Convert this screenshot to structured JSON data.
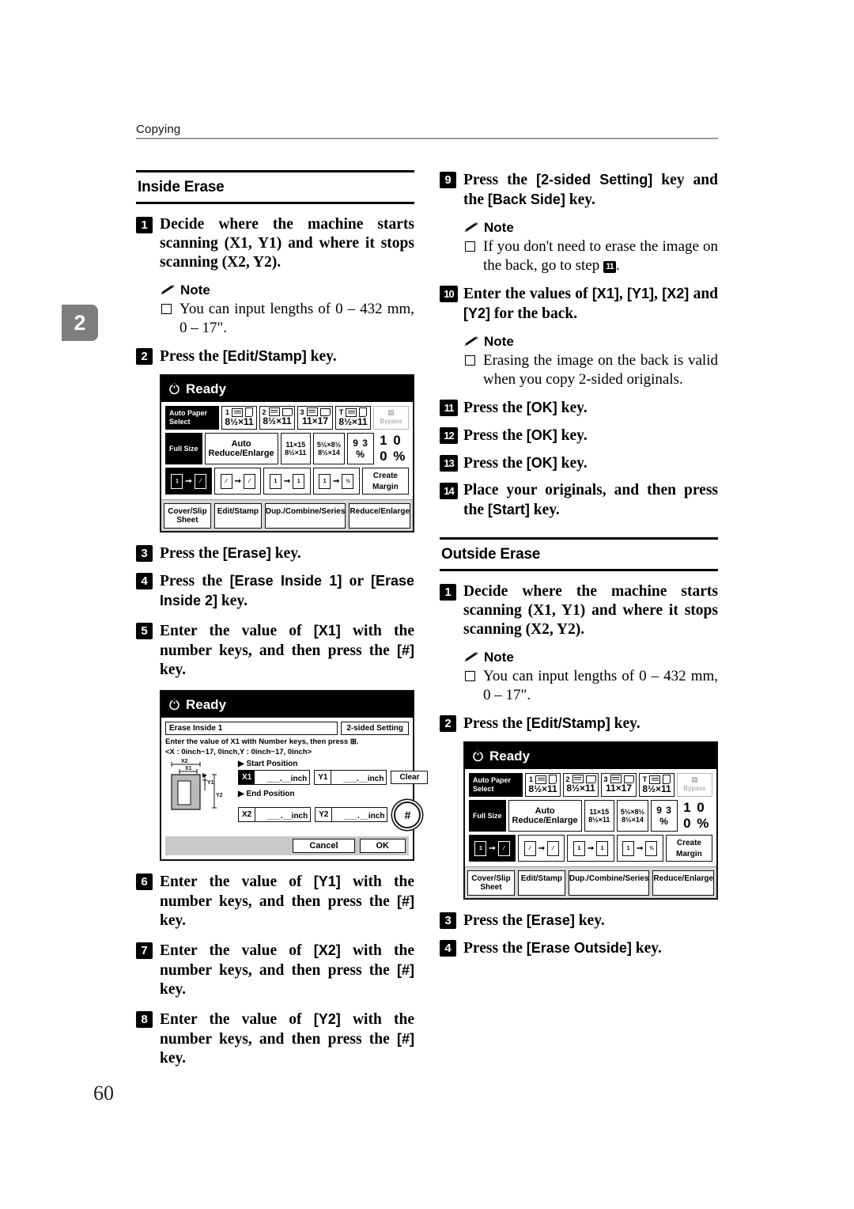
{
  "running_head": {
    "text": "Copying"
  },
  "chapter_tab": {
    "number": "2"
  },
  "page_number": "60",
  "left_column": {
    "section": {
      "title": "Inside Erase"
    },
    "steps": [
      {
        "num": "1",
        "text": "Decide where the machine starts scanning (X1, Y1) and where it stops scanning (X2, Y2)."
      },
      {
        "num": "2",
        "text_pre": "Press the ",
        "key": "[Edit/Stamp]",
        "text_post": " key."
      },
      {
        "num": "3",
        "text_pre": "Press the ",
        "key": "[Erase]",
        "text_post": " key."
      },
      {
        "num": "4",
        "text_pre": "Press the ",
        "key": "[Erase Inside 1]",
        "mid": " or ",
        "key2": "[Erase Inside 2]",
        "text_post": " key."
      },
      {
        "num": "5",
        "text_pre": "Enter the value of ",
        "key": "[X1]",
        "text_post": " with the number keys, and then press the ",
        "key2": "[#]",
        "tail": " key."
      },
      {
        "num": "6",
        "text_pre": "Enter the value of ",
        "key": "[Y1]",
        "text_post": " with the number keys, and then press the ",
        "key2": "[#]",
        "tail": " key."
      },
      {
        "num": "7",
        "text_pre": "Enter the value of ",
        "key": "[X2]",
        "text_post": " with the number keys, and then press the ",
        "key2": "[#]",
        "tail": " key."
      },
      {
        "num": "8",
        "text_pre": "Enter the value of ",
        "key": "[Y2]",
        "text_post": " with the number keys, and then press the ",
        "key2": "[#]",
        "tail": " key."
      }
    ],
    "note1": {
      "title": "Note",
      "item": "You can input lengths of 0 – 432 mm, 0 – 17\"."
    }
  },
  "right_column": {
    "steps": [
      {
        "num": "9",
        "text_pre": "Press the ",
        "key": "[2-sided Setting]",
        "mid": " key and the ",
        "key2": "[Back Side]",
        "text_post": " key."
      },
      {
        "num": "10",
        "text_pre": "Enter the values of ",
        "key": "[X1]",
        "k2": "[Y1]",
        "k3": "[X2]",
        "k4": "[Y2]",
        "text_post": " for the back."
      },
      {
        "num": "11",
        "text_pre": "Press the ",
        "key": "[OK]",
        "text_post": " key."
      },
      {
        "num": "12",
        "text_pre": "Press the ",
        "key": "[OK]",
        "text_post": " key."
      },
      {
        "num": "13",
        "text_pre": "Press the ",
        "key": "[OK]",
        "text_post": " key."
      },
      {
        "num": "14",
        "text_pre": "Place your originals, and then press the ",
        "key": "[Start]",
        "text_post": " key."
      }
    ],
    "note9": {
      "title": "Note",
      "item_pre": "If you don't need to erase the image on the back, go to step ",
      "step_ref": "11",
      "item_post": "."
    },
    "note10": {
      "title": "Note",
      "item": "Erasing the image on the back is valid when you copy 2-sided originals."
    },
    "section": {
      "title": "Outside Erase"
    },
    "outside_steps": [
      {
        "num": "1",
        "text": "Decide where the machine starts scanning (X1, Y1) and where it stops scanning (X2, Y2)."
      },
      {
        "num": "2",
        "text_pre": "Press the ",
        "key": "[Edit/Stamp]",
        "text_post": " key."
      },
      {
        "num": "3",
        "text_pre": "Press the ",
        "key": "[Erase]",
        "text_post": " key."
      },
      {
        "num": "4",
        "text_pre": "Press the ",
        "key": "[Erase Outside]",
        "text_post": " key."
      }
    ],
    "note_outside": {
      "title": "Note",
      "item": "You can input lengths of 0 – 432 mm, 0 – 17\"."
    }
  },
  "lcd_main": {
    "status": "Ready",
    "auto_paper_select": "Auto Paper Select",
    "paper_trays": [
      {
        "id": "1",
        "size": "8½×11"
      },
      {
        "id": "2",
        "size": "8½×11"
      },
      {
        "id": "3",
        "size": "11×17"
      },
      {
        "id": "T",
        "size": "8½×11"
      },
      {
        "id": "",
        "size": "Bypass"
      }
    ],
    "full_size": "Full Size",
    "auto_reduce": "Auto Reduce/Enlarge",
    "preset1_top": "11×15",
    "preset1_bot": "8½×11",
    "preset2_top": "5½×8½",
    "preset2_bot": "8½×14",
    "ratio_preset": "9 3 %",
    "ratio_current": "1 0 0 %",
    "create_margin_l1": "Create",
    "create_margin_l2": "Margin",
    "bottom_tabs": [
      "Cover/Slip Sheet",
      "Edit/Stamp",
      "Dup./Combine/Series",
      "Reduce/Enlarge"
    ]
  },
  "lcd_dialog": {
    "status": "Ready",
    "dialog_name": "Erase Inside 1",
    "two_sided_tab": "2-sided Setting",
    "instruction_line1": "Enter the value of X1 with Number keys, then press",
    "instruction_line2": "<X : 0inch~17, 0inch,Y : 0inch~17, 0inch>",
    "start_position": "Start Position",
    "end_position": "End Position",
    "fields": [
      {
        "tag": "X1",
        "value": "___.__inch"
      },
      {
        "tag": "Y1",
        "value": "___.__inch"
      },
      {
        "tag": "X2",
        "value": "___.__inch"
      },
      {
        "tag": "Y2",
        "value": "___.__inch"
      }
    ],
    "clear_label": "Clear",
    "hash_label": "#",
    "cancel_label": "Cancel",
    "ok_label": "OK",
    "diagram_labels": [
      "X2",
      "X1",
      "Y1",
      "Y2"
    ]
  }
}
